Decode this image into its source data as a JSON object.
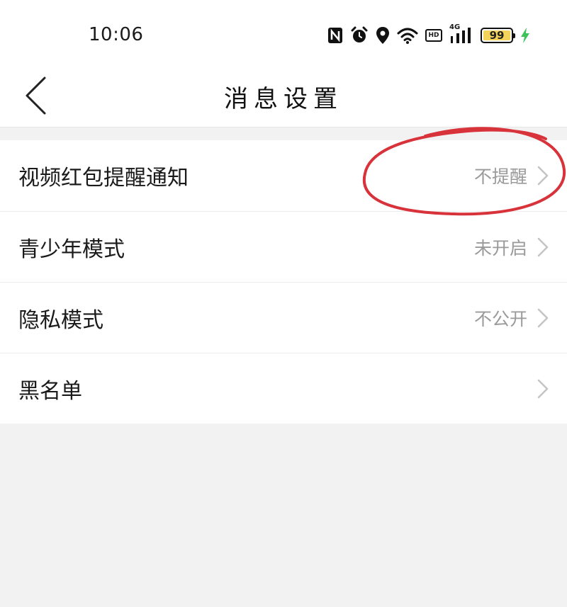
{
  "status_bar": {
    "time": "10:06",
    "network": "4G",
    "hd_label": "HD",
    "battery": "99",
    "icons": [
      "nfc-icon",
      "alarm-icon",
      "location-icon",
      "wifi-icon",
      "hd-icon",
      "signal-icon",
      "battery-icon",
      "charging-icon"
    ],
    "battery_fill_color": "#f3d35a",
    "charging_color": "#3cc35a"
  },
  "header": {
    "title": "消息设置",
    "back_icon": "chevron-left-icon"
  },
  "settings": {
    "items": [
      {
        "label": "视频红包提醒通知",
        "value": "不提醒"
      },
      {
        "label": "青少年模式",
        "value": "未开启"
      },
      {
        "label": "隐私模式",
        "value": "不公开"
      },
      {
        "label": "黑名单",
        "value": ""
      }
    ]
  },
  "annotation": {
    "color": "#d8323a",
    "shape": "hand-drawn-circle"
  }
}
